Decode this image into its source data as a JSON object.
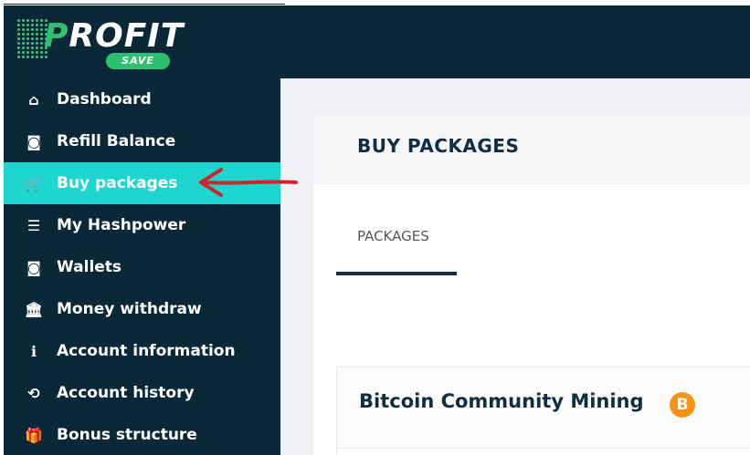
{
  "brand": {
    "name_initial": "P",
    "name_rest": "ROFIT",
    "badge": "SAVE"
  },
  "sidebar": {
    "items": [
      {
        "label": "Dashboard",
        "icon": "home-icon",
        "glyph": "⌂",
        "active": false
      },
      {
        "label": "Refill Balance",
        "icon": "money-icon",
        "glyph": "◙",
        "active": false
      },
      {
        "label": "Buy packages",
        "icon": "cart-icon",
        "glyph": "🛒",
        "active": true
      },
      {
        "label": "My Hashpower",
        "icon": "list-icon",
        "glyph": "☰",
        "active": false
      },
      {
        "label": "Wallets",
        "icon": "wallet-icon",
        "glyph": "◙",
        "active": false
      },
      {
        "label": "Money withdraw",
        "icon": "bank-icon",
        "glyph": "🏛",
        "active": false
      },
      {
        "label": "Account information",
        "icon": "info-icon",
        "glyph": "ℹ",
        "active": false
      },
      {
        "label": "Account history",
        "icon": "history-icon",
        "glyph": "⟲",
        "active": false
      },
      {
        "label": "Bonus structure",
        "icon": "gift-icon",
        "glyph": "🎁",
        "active": false
      }
    ]
  },
  "main": {
    "title": "BUY PACKAGES",
    "tabs": [
      {
        "label": "PACKAGES",
        "active": true
      }
    ],
    "package": {
      "title": "Bitcoin Community Mining",
      "coin_symbol": "B"
    }
  },
  "colors": {
    "sidebar_bg": "#0b2838",
    "active": "#1ed6cf",
    "accent_green": "#2fbf71",
    "bitcoin": "#f7931a",
    "arrow": "#d3242a"
  }
}
